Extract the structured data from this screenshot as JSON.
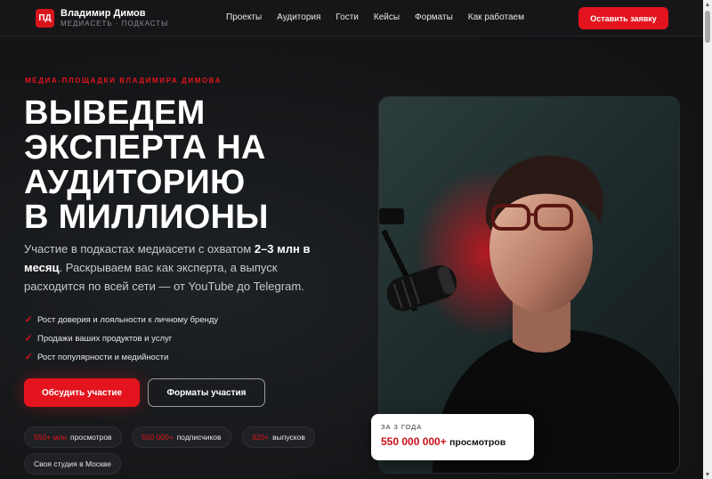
{
  "header": {
    "logo_mark": "ПД",
    "brand_name": "Владимир Димов",
    "brand_sub": "МЕДИАСЕТЬ · ПОДКАСТЫ",
    "nav": [
      "Проекты",
      "Аудитория",
      "Гости",
      "Кейсы",
      "Форматы",
      "Как работаем"
    ],
    "cta_label": "Оставить заявку"
  },
  "hero": {
    "eyebrow": "МЕДИА-ПЛОЩАДКИ ВЛАДИМИРА ДИМОВА",
    "title_lines": [
      "ВЫВЕДЕМ",
      "ЭКСПЕРТА НА",
      "АУДИТОРИЮ",
      "В МИЛЛИОНЫ"
    ],
    "lead_parts": [
      "Участие в подкастах медиасети с охватом ",
      "2–3 млн в месяц",
      ". Раскрываем вас как эксперта, а выпуск расходится по всей сети — от YouTube до Telegram."
    ],
    "benefits": [
      "Рост доверия и лояльности к личному бренду",
      "Продажи ваших продуктов и услуг",
      "Рост популярности и медийности"
    ],
    "primary_button": "Обсудить участие",
    "secondary_button": "Форматы участия",
    "chips": [
      {
        "num": "550+ млн",
        "text": "просмотров"
      },
      {
        "num": "550 000+",
        "text": "подписчиков"
      },
      {
        "num": "320+",
        "text": "выпусков"
      },
      {
        "num": "",
        "text": "Своя студия в Москве"
      }
    ]
  },
  "stat_card": {
    "label": "ЗА 3 ГОДА",
    "value": "550 000 000+",
    "unit": "просмотров"
  },
  "colors": {
    "accent": "#e3141d",
    "background": "#141416",
    "card": "#ffffff"
  }
}
